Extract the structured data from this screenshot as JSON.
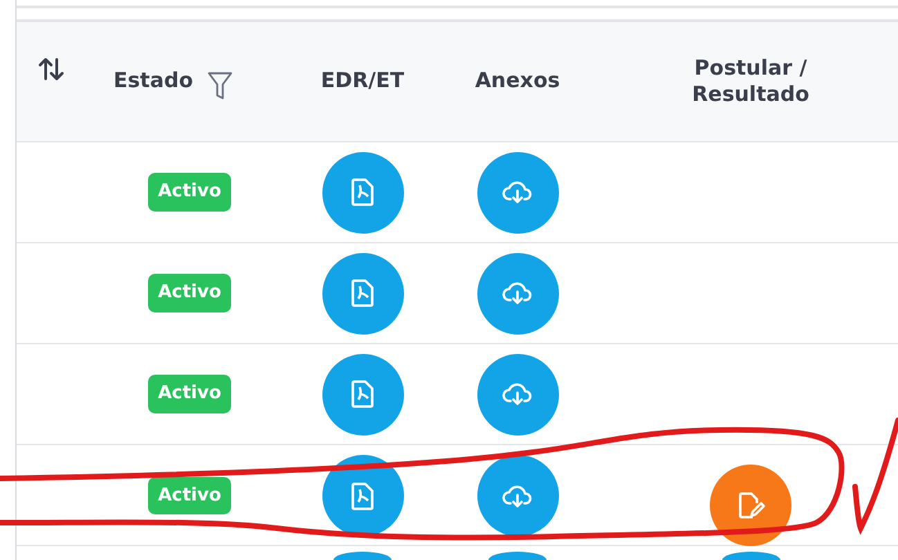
{
  "columns": [
    {
      "kind": "sort"
    },
    {
      "kind": "filter",
      "label": "Estado"
    },
    {
      "kind": "text",
      "label": "EDR/ET"
    },
    {
      "kind": "text",
      "label": "Anexos"
    },
    {
      "kind": "text",
      "label": "Postular / Resultado"
    }
  ],
  "rows": [
    {
      "kind": "full",
      "estado": "Activo",
      "circled": false
    },
    {
      "kind": "full",
      "estado": "Activo",
      "circled": false
    },
    {
      "kind": "full",
      "estado": "Activo",
      "circled": false
    },
    {
      "kind": "full",
      "estado": "Activo",
      "action": {
        "kind": "edit"
      },
      "circled": true
    },
    {
      "kind": "cut",
      "action": {
        "kind": "result"
      }
    }
  ]
}
